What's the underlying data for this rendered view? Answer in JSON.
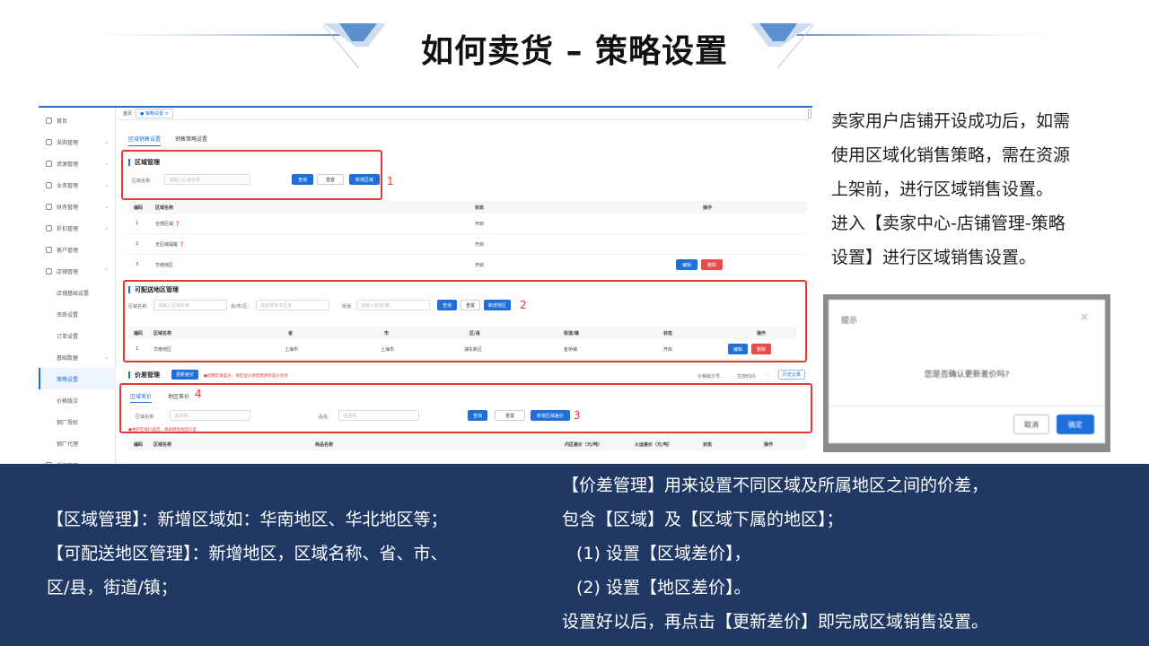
{
  "slide_title": "如何卖货 – 策略设置",
  "screenshot": {
    "nav": [
      {
        "label": "首页",
        "chev": ""
      },
      {
        "label": "采购管理",
        "chev": "⌄"
      },
      {
        "label": "资源管理",
        "chev": "⌄"
      },
      {
        "label": "业务管理",
        "chev": "⌄"
      },
      {
        "label": "财务管理",
        "chev": "⌄"
      },
      {
        "label": "折扣管理",
        "chev": "⌄"
      },
      {
        "label": "客户管理",
        "chev": ""
      },
      {
        "label": "店铺管理",
        "chev": "⌃"
      },
      {
        "label": "店铺基础设置",
        "chev": ""
      },
      {
        "label": "资质设置",
        "chev": ""
      },
      {
        "label": "订单设置",
        "chev": ""
      },
      {
        "label": "基础数据",
        "chev": "⌄"
      },
      {
        "label": "策略设置",
        "chev": ""
      },
      {
        "label": "价格版次",
        "chev": ""
      },
      {
        "label": "钢厂授权",
        "chev": ""
      },
      {
        "label": "钢厂代理",
        "chev": ""
      },
      {
        "label": "报表管理",
        "chev": "⌄"
      }
    ],
    "crumb_home": "首页",
    "crumb_tab": "● 策略设置 ×",
    "tab_region": "区域销售设置",
    "tab_policy": "销售策略设置",
    "region_mgmt": {
      "title": "区域管理",
      "name_label": "区域名称:",
      "name_placeholder": "请输入区域名称",
      "query": "查询",
      "reset": "重置",
      "add": "新增区域",
      "marker": "1"
    },
    "region_table": {
      "headers": [
        "编码",
        "区域名称",
        "状态",
        "操作"
      ],
      "rows": [
        {
          "id": "1",
          "name": "全部区域 ❓",
          "status": "开启"
        },
        {
          "id": "2",
          "name": "无区域提醒 ❓",
          "status": "开启"
        },
        {
          "id": "3",
          "name": "华南地区",
          "status": "开启"
        }
      ],
      "edit": "编辑",
      "delete": "删除"
    },
    "area_mgmt": {
      "title": "可配送地区管理",
      "name_label": "区域名称:",
      "name_placeholder": "请输入区域名称",
      "pca_label": "省/市/区:",
      "pca_placeholder": "请选择省市区县",
      "street_label": "街道:",
      "street_placeholder": "请输入街道/镇",
      "query": "查询",
      "reset": "重置",
      "add": "新增地区",
      "marker": "2"
    },
    "area_table": {
      "headers": [
        "编码",
        "区域名称",
        "省",
        "市",
        "区/县",
        "街道/镇",
        "状态",
        "操作"
      ],
      "row": {
        "id": "1",
        "name": "华南地区",
        "prov": "上海市",
        "city": "上海市",
        "dist": "浦东新区",
        "street": "金桥镇",
        "status": "开启"
      },
      "edit": "编辑",
      "delete": "删除"
    },
    "price_mgmt": {
      "title": "价差管理",
      "update": "更新差价",
      "warn": "●提醒区域差价，地区差价改后需更新差价生效",
      "version_label": "价格版次号:",
      "effective_label": "生效时间:",
      "effective_value": "-",
      "history": "历史记录",
      "tab_region": "区域差价",
      "tab_area": "地区差价",
      "marker_tab": "4",
      "name_label": "区域名称:",
      "name_placeholder": "请选择",
      "product_label": "品名:",
      "product_placeholder": "请选择",
      "query": "查询",
      "reset": "重置",
      "add": "新增区域差价",
      "marker": "3",
      "maint_hint": "●维护区域价差后，请再继续地区价差",
      "headers": [
        "编码",
        "区域名称",
        "商品名称",
        "内区差价（元/吨）",
        "火运差价（元/吨）",
        "状态",
        "操作"
      ]
    }
  },
  "right_text": [
    "卖家用户店铺开设成功后，如需",
    "使用区域化销售策略，需在资源",
    "上架前，进行区域销售设置。",
    "进入【卖家中心-店铺管理-策略",
    "设置】进行区域销售设置。"
  ],
  "dialog": {
    "title": "提示",
    "close": "×",
    "body": "您是否确认更新差价吗?",
    "cancel": "取消",
    "confirm": "确定"
  },
  "bottom_left": [
    "【区域管理】：新增区域如：华南地区、华北地区等；",
    "【可配送地区管理】：新增地区，区域名称、省、市、",
    "区/县，街道/镇；"
  ],
  "bottom_right": [
    "【价差管理】用来设置不同区域及所属地区之间的价差，",
    "包含【区域】及【区域下属的地区】；",
    "(1) 设置【区域差价】，",
    "(2) 设置【地区差价】。",
    "设置好以后，再点击【更新差价】即完成区域销售设置。"
  ],
  "colors": {
    "band": "#1f3864",
    "accent": "#1e6fd9",
    "marker": "#e53935"
  }
}
